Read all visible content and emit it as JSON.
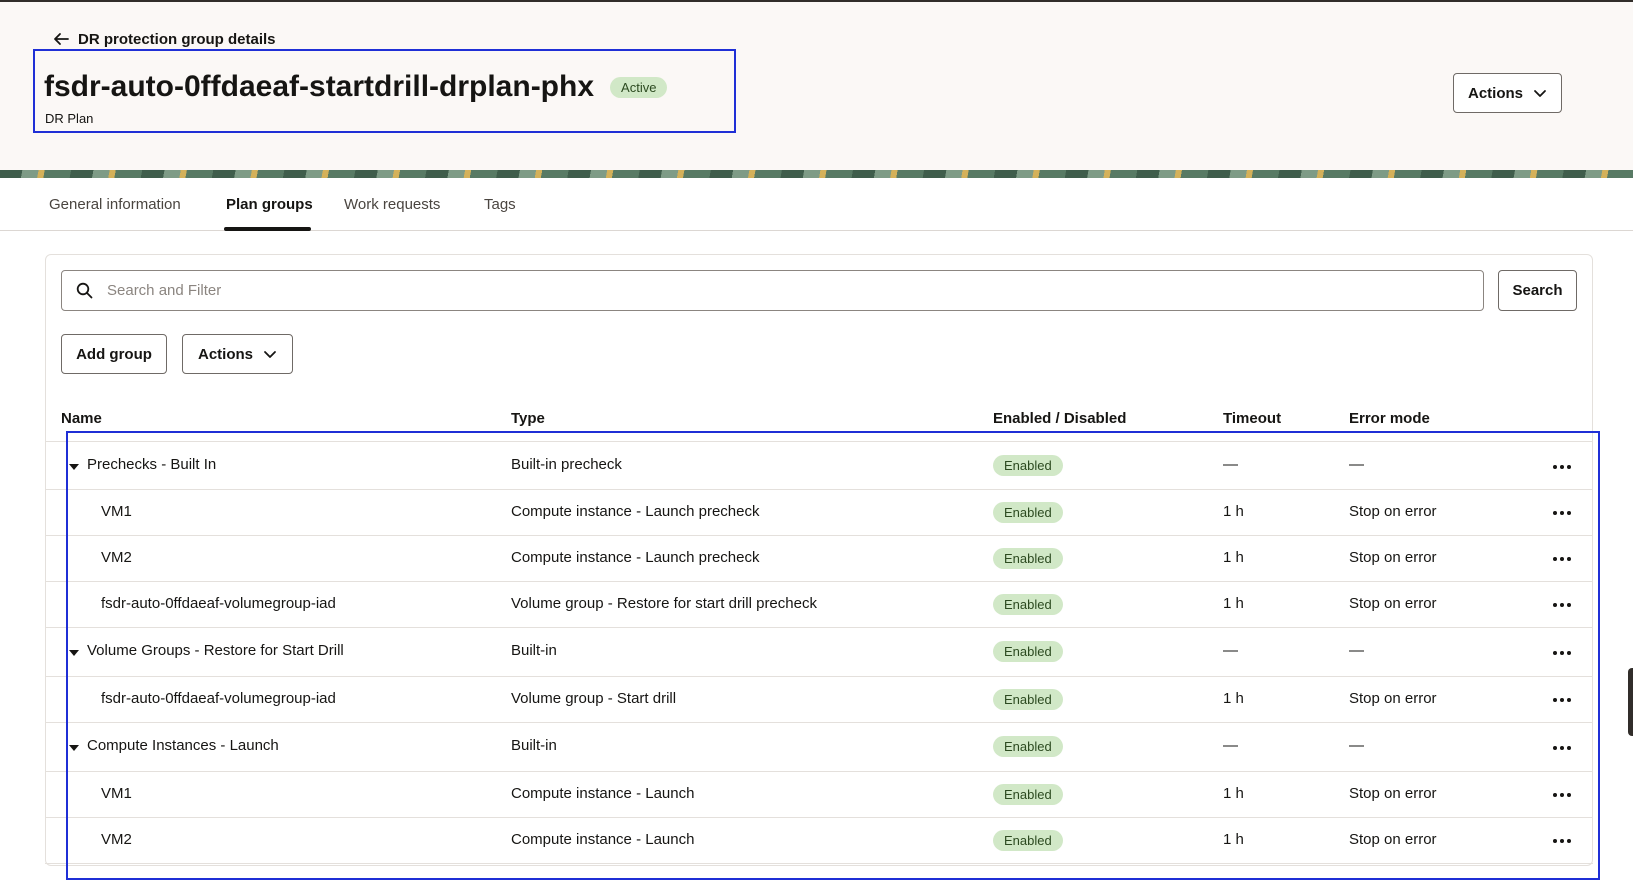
{
  "header": {
    "back_label": "DR protection group details",
    "title": "fsdr-auto-0ffdaeaf-startdrill-drplan-phx",
    "status": "Active",
    "subtitle": "DR Plan",
    "actions_label": "Actions"
  },
  "tabs": [
    {
      "label": "General information",
      "active": false
    },
    {
      "label": "Plan groups",
      "active": true
    },
    {
      "label": "Work requests",
      "active": false
    },
    {
      "label": "Tags",
      "active": false
    }
  ],
  "toolbar": {
    "search_placeholder": "Search and Filter",
    "search_button": "Search",
    "add_group_label": "Add group",
    "actions_label": "Actions"
  },
  "table": {
    "columns": [
      "Name",
      "Type",
      "Enabled / Disabled",
      "Timeout",
      "Error mode"
    ],
    "rows": [
      {
        "name": "Prechecks - Built In",
        "type": "Built-in precheck",
        "status": "Enabled",
        "timeout": "—",
        "error_mode": "—",
        "group": true
      },
      {
        "name": "VM1",
        "type": "Compute instance - Launch precheck",
        "status": "Enabled",
        "timeout": "1 h",
        "error_mode": "Stop on error",
        "group": false
      },
      {
        "name": "VM2",
        "type": "Compute instance - Launch precheck",
        "status": "Enabled",
        "timeout": "1 h",
        "error_mode": "Stop on error",
        "group": false
      },
      {
        "name": "fsdr-auto-0ffdaeaf-volumegroup-iad",
        "type": "Volume group - Restore for start drill precheck",
        "status": "Enabled",
        "timeout": "1 h",
        "error_mode": "Stop on error",
        "group": false
      },
      {
        "name": "Volume Groups - Restore for Start Drill",
        "type": "Built-in",
        "status": "Enabled",
        "timeout": "—",
        "error_mode": "—",
        "group": true
      },
      {
        "name": "fsdr-auto-0ffdaeaf-volumegroup-iad",
        "type": "Volume group - Start drill",
        "status": "Enabled",
        "timeout": "1 h",
        "error_mode": "Stop on error",
        "group": false
      },
      {
        "name": "Compute Instances - Launch",
        "type": "Built-in",
        "status": "Enabled",
        "timeout": "—",
        "error_mode": "—",
        "group": true
      },
      {
        "name": "VM1",
        "type": "Compute instance - Launch",
        "status": "Enabled",
        "timeout": "1 h",
        "error_mode": "Stop on error",
        "group": false
      },
      {
        "name": "VM2",
        "type": "Compute instance - Launch",
        "status": "Enabled",
        "timeout": "1 h",
        "error_mode": "Stop on error",
        "group": false
      }
    ]
  },
  "icons": {
    "back": "arrow-left-icon",
    "dropdown": "chevron-down-icon",
    "search": "search-icon",
    "expand": "caret-down-icon",
    "row_menu": "more-horizontal-icon"
  },
  "colors": {
    "status_bg": "#d1e8c7",
    "status_text": "#2c4a20",
    "highlight_border": "#1f2fd6",
    "header_bg": "#fbf8f6"
  }
}
